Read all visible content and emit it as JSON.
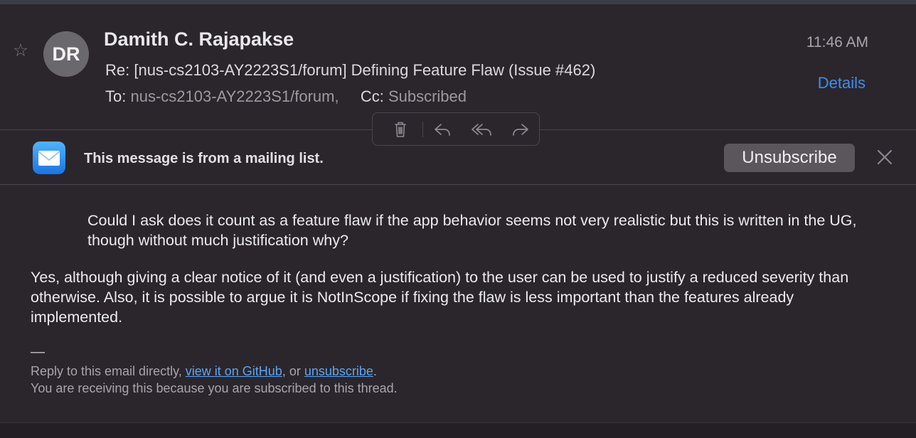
{
  "header": {
    "star_glyph": "☆",
    "avatar_initials": "DR",
    "sender": "Damith C. Rajapakse",
    "subject": "Re: [nus-cs2103-AY2223S1/forum] Defining Feature Flaw (Issue #462)",
    "to_label": "To:",
    "to_value": "nus-cs2103-AY2223S1/forum,",
    "cc_label": "Cc:",
    "cc_value": "Subscribed",
    "time": "11:46 AM",
    "details_label": "Details"
  },
  "toolbar": {
    "icons": [
      "trash-icon",
      "reply-icon",
      "reply-all-icon",
      "forward-icon"
    ]
  },
  "banner": {
    "text": "This message is from a mailing list.",
    "unsubscribe_label": "Unsubscribe"
  },
  "message": {
    "quote": "Could I ask does it count as a feature flaw if the app behavior seems not very realistic but this is written in the UG, though without much justification why?",
    "reply": "Yes, although giving a clear notice of it (and even a justification) to the user can be used to justify a reduced severity than otherwise. Also, it is possible to argue it is NotInScope if fixing the flaw is less important than the features already implemented.",
    "signature_dash": "—",
    "footer_prefix": "Reply to this email directly,",
    "footer_link1": "view it on GitHub",
    "footer_mid": ", or",
    "footer_link2": "unsubscribe",
    "footer_end": ".",
    "footer_line2": "You are receiving this because you are subscribed to this thread."
  },
  "colors": {
    "accent_link": "#3d8ff0",
    "background": "#2b262c"
  }
}
